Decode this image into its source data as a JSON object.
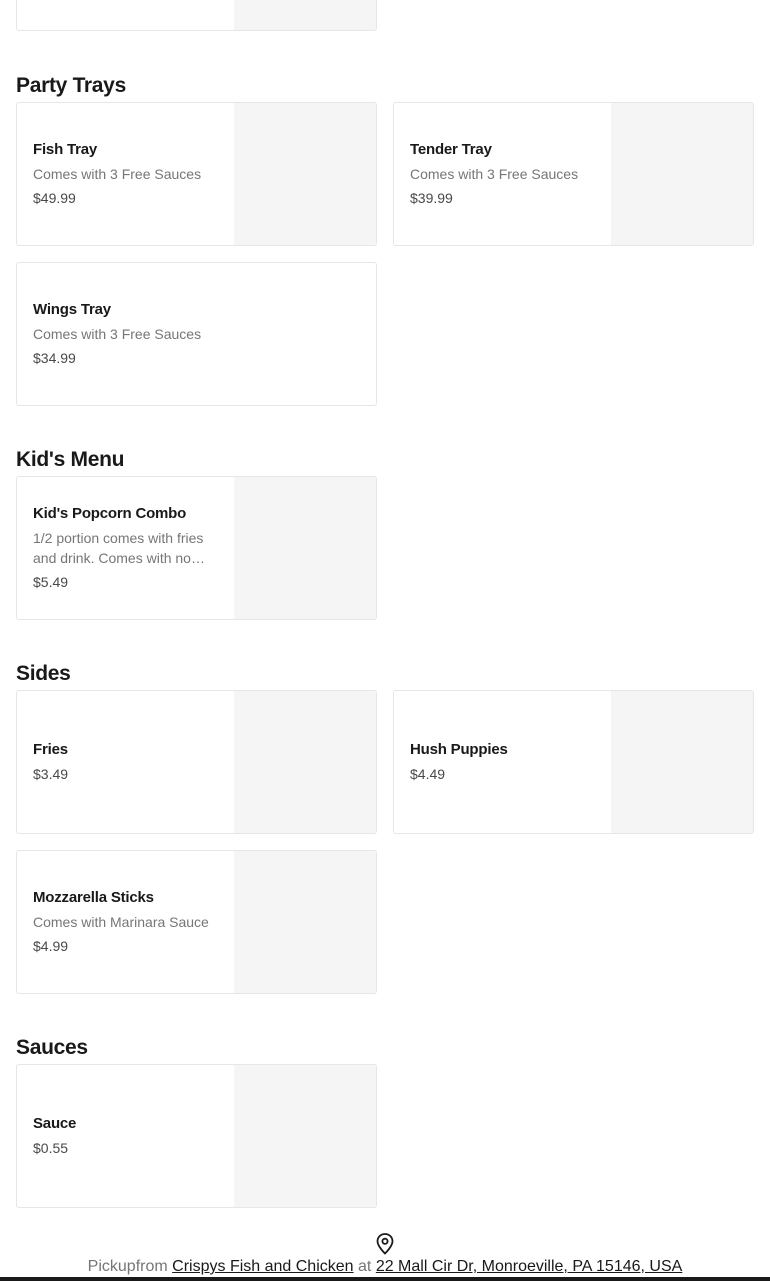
{
  "sections": [
    {
      "title": "Party Trays"
    },
    {
      "title": "Kid's Menu"
    },
    {
      "title": "Sides"
    },
    {
      "title": "Sauces"
    }
  ],
  "items": {
    "fish_tray": {
      "name": "Fish Tray",
      "desc": "Comes with 3 Free Sauces",
      "price": "$49.99"
    },
    "tender_tray": {
      "name": "Tender Tray",
      "desc": "Comes with 3 Free Sauces",
      "price": "$39.99"
    },
    "wings_tray": {
      "name": "Wings Tray",
      "desc": "Comes with 3 Free Sauces",
      "price": "$34.99"
    },
    "kids_popcorn": {
      "name": "Kid's Popcorn Combo",
      "desc": "1/2 portion comes with fries and drink. Comes with no…",
      "price": "$5.49"
    },
    "fries": {
      "name": "Fries",
      "price": "$3.49"
    },
    "hush_puppies": {
      "name": "Hush Puppies",
      "price": "$4.49"
    },
    "mozzarella": {
      "name": "Mozzarella Sticks",
      "desc": "Comes with Marinara Sauce",
      "price": "$4.99"
    },
    "sauce": {
      "name": "Sauce",
      "price": "$0.55"
    }
  },
  "footer": {
    "pickup_label": "Pickupfrom",
    "restaurant": "Crispys Fish and Chicken",
    "at_label": "at",
    "address": "22 Mall Cir Dr, Monroeville, PA 15146, USA",
    "icon": "location-pin-icon"
  },
  "colors": {
    "text": "#191919",
    "muted": "#767676",
    "placeholder": "#f5f5f5",
    "border": "#e6e6e6"
  }
}
